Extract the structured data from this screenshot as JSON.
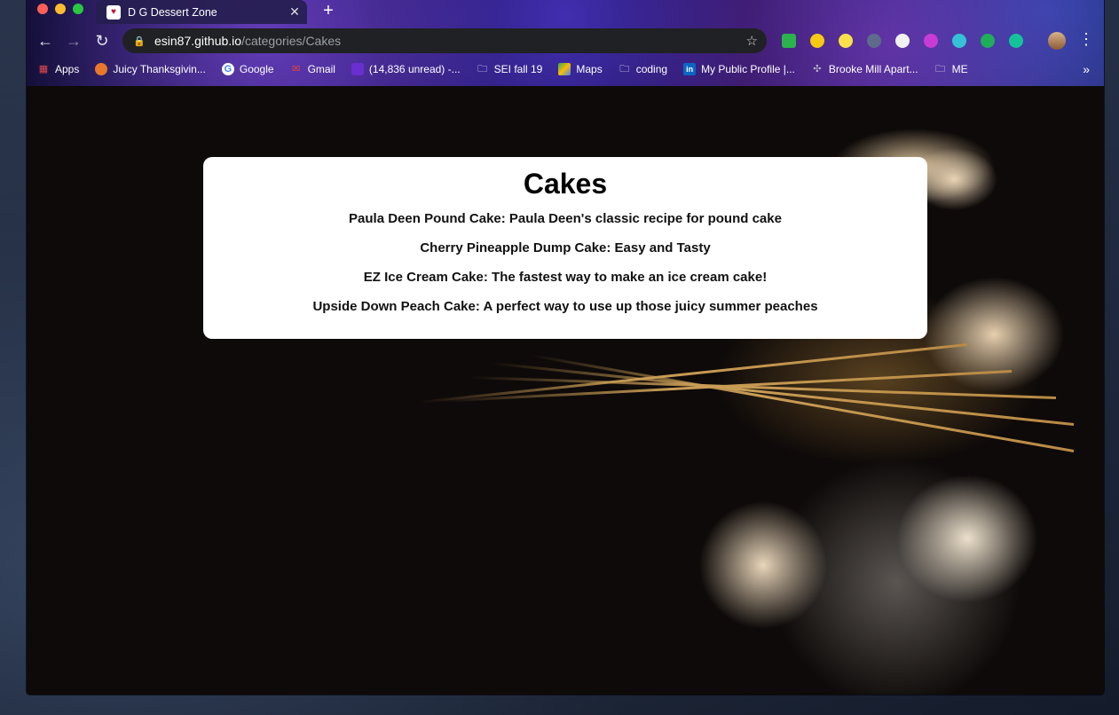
{
  "browser": {
    "tab": {
      "title": "D G Dessert Zone",
      "favicon": "cupcake-icon"
    },
    "url": {
      "host": "esin87.github.io",
      "path": "/categories/Cakes"
    },
    "bookmarks": [
      {
        "label": "Apps",
        "icon": "apps-grid-icon"
      },
      {
        "label": "Juicy Thanksgivin...",
        "icon": "site-favicon"
      },
      {
        "label": "Google",
        "icon": "google-icon"
      },
      {
        "label": "Gmail",
        "icon": "gmail-icon"
      },
      {
        "label": "(14,836 unread) -...",
        "icon": "mail-icon"
      },
      {
        "label": "SEI fall 19",
        "icon": "folder-icon"
      },
      {
        "label": "Maps",
        "icon": "maps-icon"
      },
      {
        "label": "coding",
        "icon": "folder-icon"
      },
      {
        "label": "My Public Profile |...",
        "icon": "linkedin-icon"
      },
      {
        "label": "Brooke Mill Apart...",
        "icon": "site-favicon"
      },
      {
        "label": "ME",
        "icon": "folder-icon"
      }
    ]
  },
  "page": {
    "title": "Cakes",
    "recipes": [
      "Paula Deen Pound Cake: Paula Deen's classic recipe for pound cake",
      "Cherry Pineapple Dump Cake: Easy and Tasty",
      "EZ Ice Cream Cake: The fastest way to make an ice cream cake!",
      "Upside Down Peach Cake: A perfect way to use up those juicy summer peaches"
    ]
  }
}
